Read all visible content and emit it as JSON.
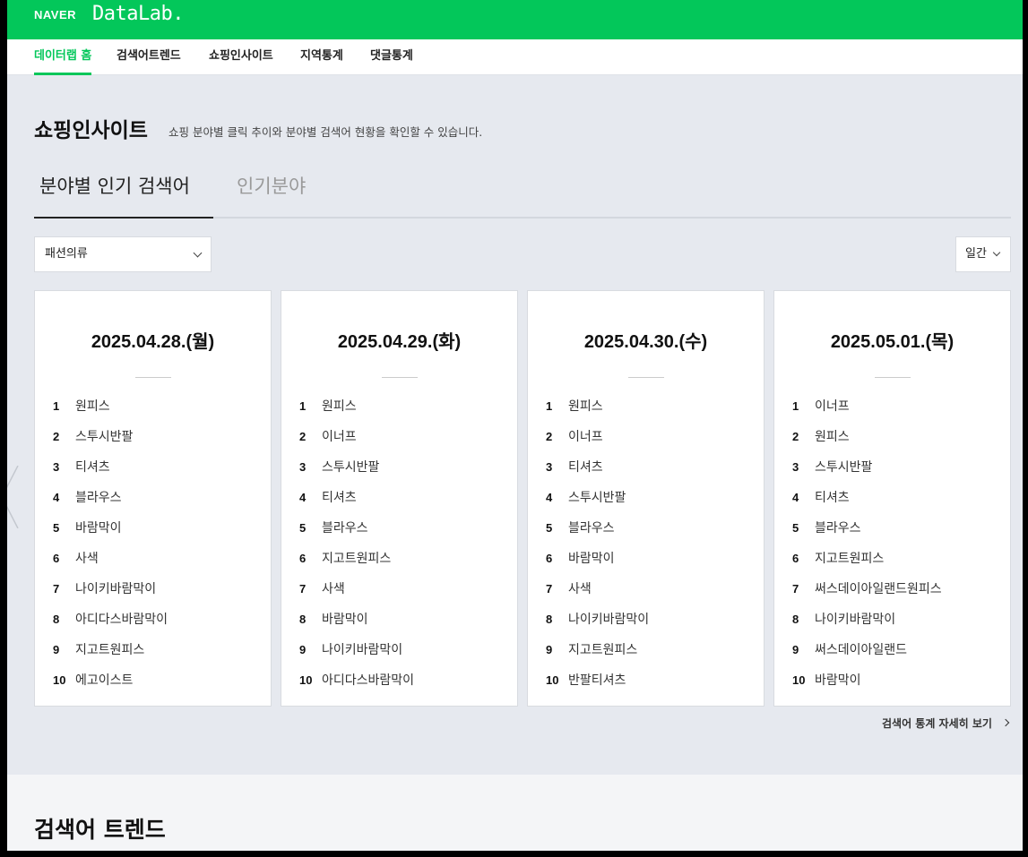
{
  "header": {
    "brand": "NAVER",
    "product": "DataLab."
  },
  "nav": [
    {
      "label": "데이터랩 홈",
      "active": true
    },
    {
      "label": "검색어트렌드",
      "active": false
    },
    {
      "label": "쇼핑인사이트",
      "active": false
    },
    {
      "label": "지역통계",
      "active": false
    },
    {
      "label": "댓글통계",
      "active": false
    }
  ],
  "section": {
    "title": "쇼핑인사이트",
    "description": "쇼핑 분야별 클릭 추이와 분야별 검색어 현황을 확인할 수 있습니다."
  },
  "tabs": [
    {
      "label": "분야별 인기 검색어",
      "active": true
    },
    {
      "label": "인기분야",
      "active": false
    }
  ],
  "filters": {
    "category": "패션의류",
    "period": "일간"
  },
  "cards": [
    {
      "date": "2025.04.28.(월)",
      "ranks": [
        "원피스",
        "스투시반팔",
        "티셔츠",
        "블라우스",
        "바람막이",
        "사색",
        "나이키바람막이",
        "아디다스바람막이",
        "지고트원피스",
        "에고이스트"
      ]
    },
    {
      "date": "2025.04.29.(화)",
      "ranks": [
        "원피스",
        "이너프",
        "스투시반팔",
        "티셔츠",
        "블라우스",
        "지고트원피스",
        "사색",
        "바람막이",
        "나이키바람막이",
        "아디다스바람막이"
      ]
    },
    {
      "date": "2025.04.30.(수)",
      "ranks": [
        "원피스",
        "이너프",
        "티셔츠",
        "스투시반팔",
        "블라우스",
        "바람막이",
        "사색",
        "나이키바람막이",
        "지고트원피스",
        "반팔티셔츠"
      ]
    },
    {
      "date": "2025.05.01.(목)",
      "ranks": [
        "이너프",
        "원피스",
        "스투시반팔",
        "티셔츠",
        "블라우스",
        "지고트원피스",
        "써스데이아일랜드원피스",
        "나이키바람막이",
        "써스데이아일랜드",
        "바람막이"
      ]
    }
  ],
  "more_link": "검색어 통계 자세히 보기",
  "next_section": {
    "title": "검색어 트렌드"
  },
  "colors": {
    "brand": "#03c75a",
    "background": "#e6e9ef"
  },
  "icons": {
    "category_dropdown": "chevron-down-icon",
    "period_dropdown": "chevron-down-icon",
    "more": "chevron-right-icon",
    "prev": "chevron-left-icon"
  }
}
